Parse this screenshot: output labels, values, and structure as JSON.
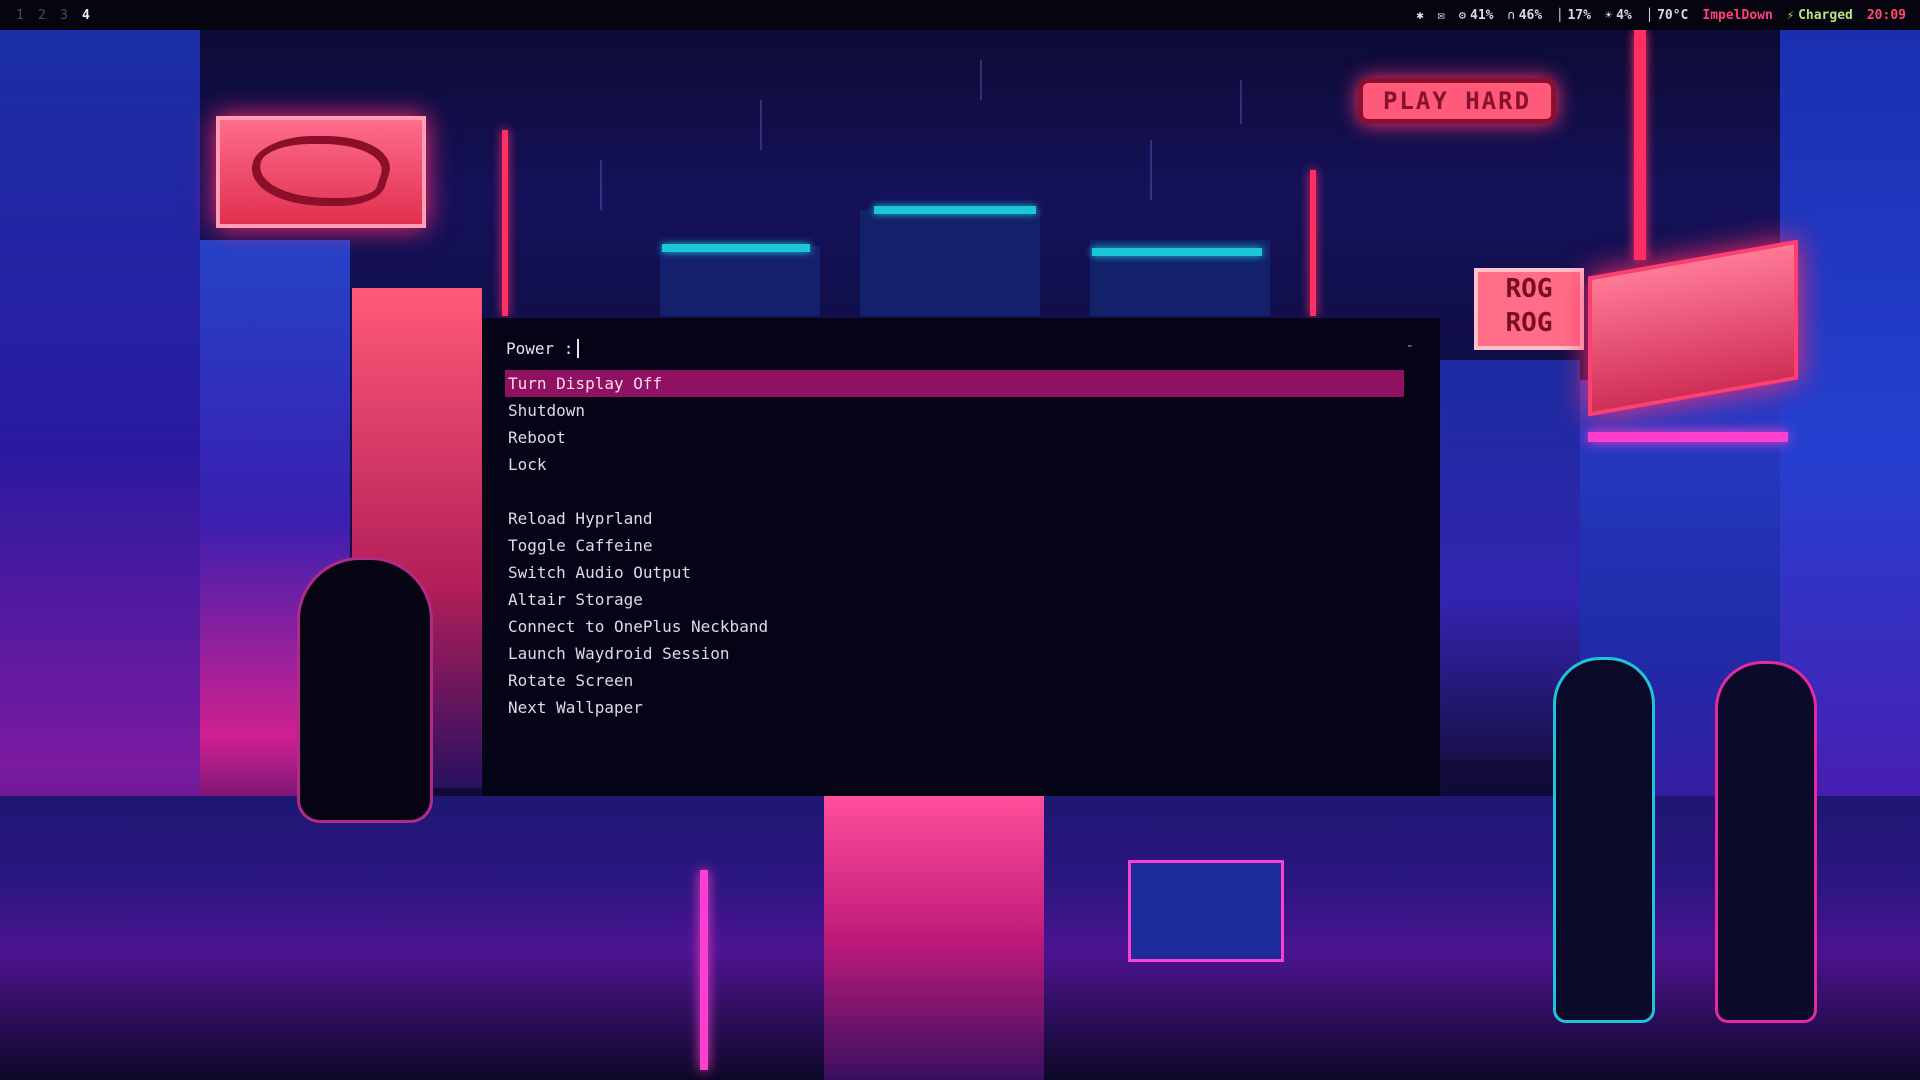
{
  "bar": {
    "workspaces": [
      {
        "label": "1",
        "active": false
      },
      {
        "label": "2",
        "active": false
      },
      {
        "label": "3",
        "active": false
      },
      {
        "label": "4",
        "active": true
      }
    ],
    "status": {
      "bluetooth_icon": "bluetooth-icon",
      "notifications_icon": "notifications-off-icon",
      "cpu": "41%",
      "volume": "46%",
      "mic": "17%",
      "brightness": "4%",
      "temperature": "70°C",
      "network": "ImpelDown",
      "battery": "Charged",
      "clock": "20:09"
    },
    "colors": {
      "network": "#ff3f7a",
      "battery": "#b6e37a",
      "clock": "#ff4f6a",
      "temperature": "#f3f3f8"
    }
  },
  "launcher": {
    "prompt": "Power :",
    "mode_indicator": "-",
    "selected_index": 0,
    "entries": [
      "Turn Display Off",
      "Shutdown",
      "Reboot",
      "Lock",
      "",
      "Reload Hyprland",
      "Toggle Caffeine",
      "Switch Audio Output",
      "Altair Storage",
      "Connect to OnePlus Neckband",
      "Launch Waydroid Session",
      "Rotate Screen",
      "Next Wallpaper"
    ],
    "colors": {
      "selected_bg": "#8f1262",
      "background": "#050416"
    }
  },
  "wallpaper": {
    "signs": {
      "play_hard": "PLAY HARD",
      "rog_rog_line1": "ROG",
      "rog_rog_line2": "ROG"
    }
  }
}
